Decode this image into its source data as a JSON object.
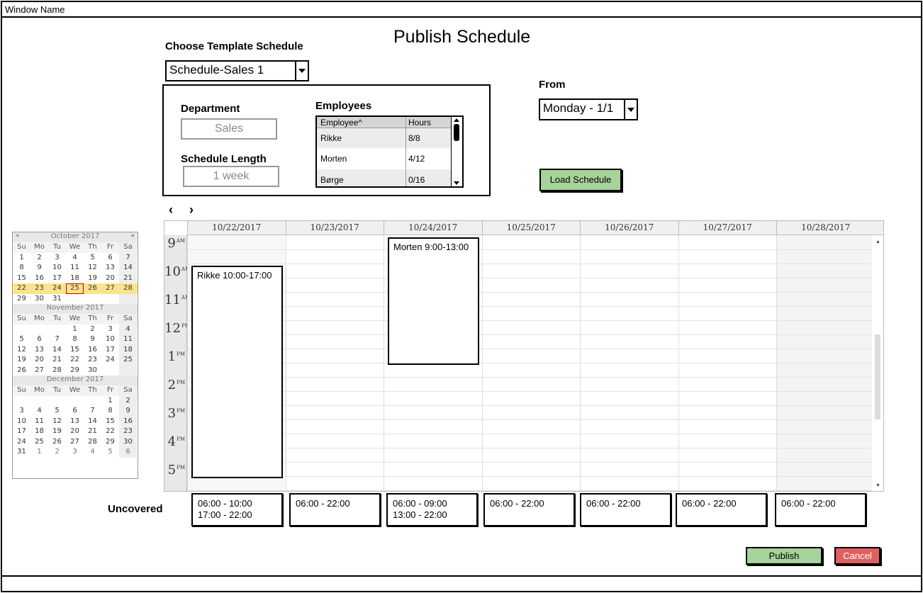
{
  "window": {
    "title": "Window Name"
  },
  "page_title": "Publish Schedule",
  "template": {
    "label": "Choose Template Schedule",
    "selected": "Schedule-Sales 1"
  },
  "department": {
    "label": "Department",
    "value": "Sales"
  },
  "schedule_length": {
    "label": "Schedule Length",
    "value": "1 week"
  },
  "employees": {
    "label": "Employees",
    "columns": [
      "Employee^",
      "Hours"
    ],
    "rows": [
      {
        "name": "Rikke",
        "hours": "8/8"
      },
      {
        "name": "Morten",
        "hours": "4/12"
      },
      {
        "name": "Børge",
        "hours": "0/16"
      }
    ]
  },
  "from": {
    "label": "From",
    "selected": "Monday - 1/1"
  },
  "load_button": "Load Schedule",
  "nav": {
    "prev": "‹",
    "next": "›"
  },
  "mini_calendar": {
    "dow": [
      "Su",
      "Mo",
      "Tu",
      "We",
      "Th",
      "Fr",
      "Sa"
    ],
    "prev_arrow": "«",
    "next_arrow": "»",
    "months": [
      {
        "name": "October 2017",
        "weeks": [
          [
            "1",
            "2",
            "3",
            "4",
            "5",
            "6",
            "7"
          ],
          [
            "8",
            "9",
            "10",
            "11",
            "12",
            "13",
            "14"
          ],
          [
            "15",
            "16",
            "17",
            "18",
            "19",
            "20",
            "21"
          ],
          [
            "22",
            "23",
            "24",
            "25",
            "26",
            "27",
            "28"
          ],
          [
            "29",
            "30",
            "31",
            "",
            "",
            "",
            ""
          ]
        ]
      },
      {
        "name": "November 2017",
        "weeks": [
          [
            "",
            "",
            "",
            "1",
            "2",
            "3",
            "4"
          ],
          [
            "5",
            "6",
            "7",
            "8",
            "9",
            "10",
            "11"
          ],
          [
            "12",
            "13",
            "14",
            "15",
            "16",
            "17",
            "18"
          ],
          [
            "19",
            "20",
            "21",
            "22",
            "23",
            "24",
            "25"
          ],
          [
            "26",
            "27",
            "28",
            "29",
            "30",
            "",
            ""
          ]
        ]
      },
      {
        "name": "December 2017",
        "weeks": [
          [
            "",
            "",
            "",
            "",
            "",
            "1",
            "2"
          ],
          [
            "3",
            "4",
            "5",
            "6",
            "7",
            "8",
            "9"
          ],
          [
            "10",
            "11",
            "12",
            "13",
            "14",
            "15",
            "16"
          ],
          [
            "17",
            "18",
            "19",
            "20",
            "21",
            "22",
            "23"
          ],
          [
            "24",
            "25",
            "26",
            "27",
            "28",
            "29",
            "30"
          ],
          [
            "31",
            "1",
            "2",
            "3",
            "4",
            "5",
            "6"
          ]
        ]
      }
    ]
  },
  "week_view": {
    "days": [
      "10/22/2017",
      "10/23/2017",
      "10/24/2017",
      "10/25/2017",
      "10/26/2017",
      "10/27/2017",
      "10/28/2017"
    ],
    "hours": [
      {
        "h": "9",
        "ampm": "AM"
      },
      {
        "h": "10",
        "ampm": "AM"
      },
      {
        "h": "11",
        "ampm": "AM"
      },
      {
        "h": "12",
        "ampm": "PM"
      },
      {
        "h": "1",
        "ampm": "PM"
      },
      {
        "h": "2",
        "ampm": "PM"
      },
      {
        "h": "3",
        "ampm": "PM"
      },
      {
        "h": "4",
        "ampm": "PM"
      },
      {
        "h": "5",
        "ampm": "PM"
      }
    ],
    "events": [
      {
        "label": "Rikke 10:00-17:00",
        "day": 0,
        "start": 10,
        "end": 17
      },
      {
        "label": "Morten 9:00-13:00",
        "day": 2,
        "start": 9,
        "end": 13
      }
    ]
  },
  "uncovered": {
    "label": "Uncovered",
    "boxes": [
      [
        "06:00 - 10:00",
        "17:00 - 22:00"
      ],
      [
        "06:00 - 22:00"
      ],
      [
        "06:00 - 09:00",
        "13:00 - 22:00"
      ],
      [
        "06:00 - 22:00"
      ],
      [
        "06:00 - 22:00"
      ],
      [
        "06:00 - 22:00"
      ],
      [
        "06:00 - 22:00"
      ]
    ]
  },
  "publish_button": "Publish",
  "cancel_button": "Cancel"
}
